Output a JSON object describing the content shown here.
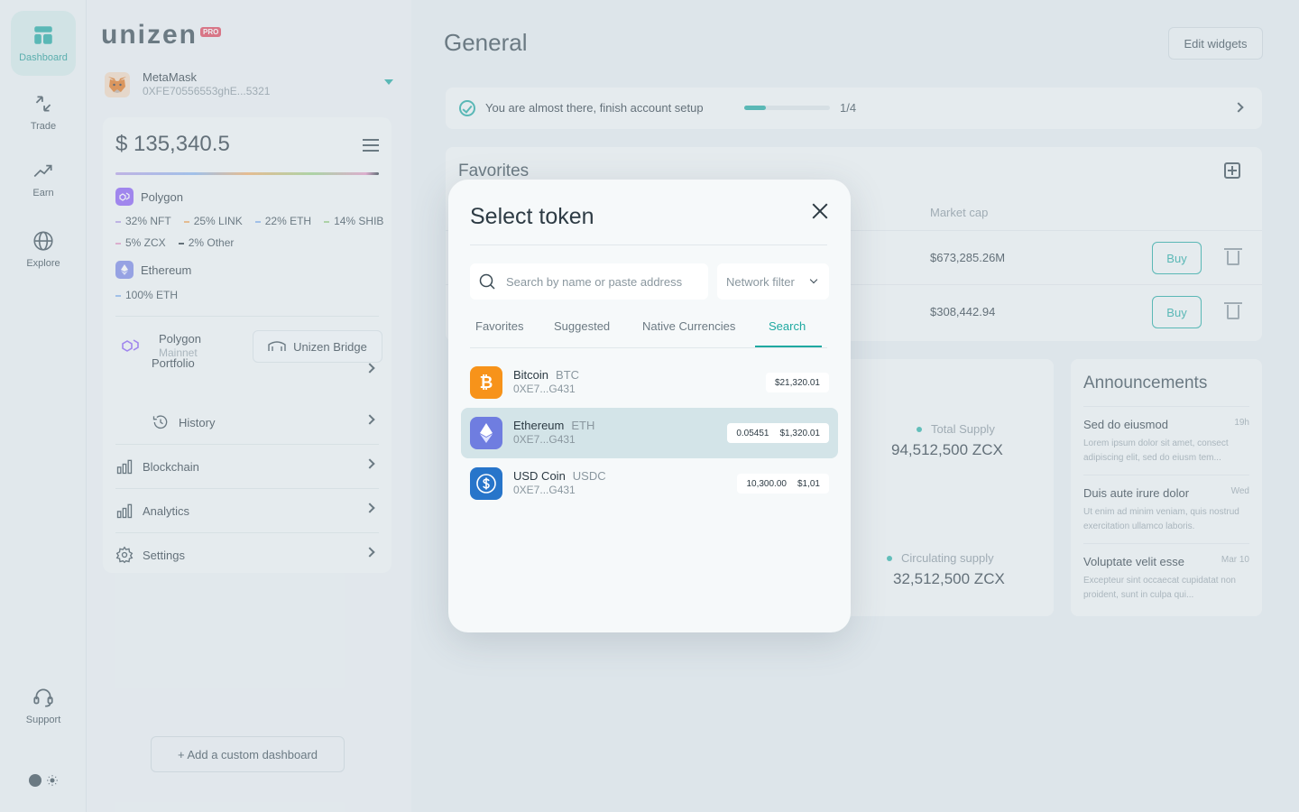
{
  "rail": {
    "items": [
      {
        "label": "Dashboard",
        "icon": "dashboard-icon"
      },
      {
        "label": "Trade",
        "icon": "trade-arrows-icon"
      },
      {
        "label": "Earn",
        "icon": "trend-up-icon"
      },
      {
        "label": "Explore",
        "icon": "globe-icon"
      }
    ],
    "support": "Support"
  },
  "brand": {
    "name": "unizen",
    "badge": "PRO"
  },
  "wallet": {
    "name": "MetaMask",
    "address": "0XFE70556553ghE...5321"
  },
  "portfolio": {
    "balance": "$ 135,340.5",
    "chains": [
      {
        "name": "Polygon",
        "color": "#8b5cf6"
      },
      {
        "name": "Ethereum",
        "color": "#7b87e6"
      }
    ],
    "polygon_alloc": [
      {
        "label": "32% NFT",
        "color": "#b9a2e8"
      },
      {
        "label": "25% LINK",
        "color": "#f3b06b"
      },
      {
        "label": "22% ETH",
        "color": "#8db6ee"
      },
      {
        "label": "14% SHIB",
        "color": "#9fd28a"
      }
    ],
    "polygon_alloc2": [
      {
        "label": "5% ZCX",
        "color": "#e69bc6"
      },
      {
        "label": "2% Other",
        "color": "#2d3b44"
      }
    ],
    "eth_alloc": [
      {
        "label": "100% ETH",
        "color": "#8db6ee"
      }
    ],
    "network": {
      "name": "Polygon",
      "sub": "Mainnet"
    },
    "bridge_button": "Unizen Bridge",
    "nav": {
      "portfolio": "Portfolio",
      "history": "History",
      "blockchain": "Blockchain",
      "analytics": "Analytics",
      "settings": "Settings"
    }
  },
  "add_dashboard": "+ Add a custom dashboard",
  "main": {
    "title": "General",
    "edit_widgets": "Edit widgets",
    "setup": {
      "text": "You are almost there, finish account setup",
      "progress": 0.25,
      "count": "1/4"
    },
    "favorites": {
      "title": "Favorites",
      "col_market_cap": "Market cap",
      "rows": [
        {
          "market_cap": "$673,285.26M",
          "action": "Buy"
        },
        {
          "market_cap": "$308,442.94",
          "action": "Buy"
        }
      ]
    },
    "supply": {
      "total_label": "Total Supply",
      "total_value": "94,512,500 ZCX",
      "circ_label": "Circulating supply",
      "circ_value": "32,512,500 ZCX"
    },
    "announcements": {
      "title": "Announcements",
      "items": [
        {
          "title": "Sed do eiusmod",
          "time": "19h",
          "body": "Lorem ipsum dolor sit amet, consect adipiscing elit, sed do eiusm tem..."
        },
        {
          "title": "Duis aute irure dolor",
          "time": "Wed",
          "body": "Ut enim ad minim veniam, quis nostrud exercitation ullamco laboris."
        },
        {
          "title": "Voluptate velit esse",
          "time": "Mar 10",
          "body": "Excepteur sint occaecat cupidatat non proident, sunt in culpa qui..."
        }
      ]
    }
  },
  "modal": {
    "title": "Select token",
    "search_placeholder": "Search by name or paste address",
    "network_filter": "Network filter",
    "tabs": [
      "Favorites",
      "Suggested",
      "Native Currencies",
      "Search"
    ],
    "active_tab": "Search",
    "tokens": [
      {
        "name": "Bitcoin",
        "symbol": "BTC",
        "address": "0XE7...G431",
        "amount": "",
        "price": "$21,320.01",
        "color": "#f7931a",
        "icon": "bitcoin-icon"
      },
      {
        "name": "Ethereum",
        "symbol": "ETH",
        "address": "0XE7...G431",
        "amount": "0.05451",
        "price": "$1,320.01",
        "color": "#6f7de0",
        "icon": "ethereum-icon"
      },
      {
        "name": "USD Coin",
        "symbol": "USDC",
        "address": "0XE7...G431",
        "amount": "10,300.00",
        "price": "$1,01",
        "color": "#2775ca",
        "icon": "usdc-icon"
      }
    ]
  }
}
